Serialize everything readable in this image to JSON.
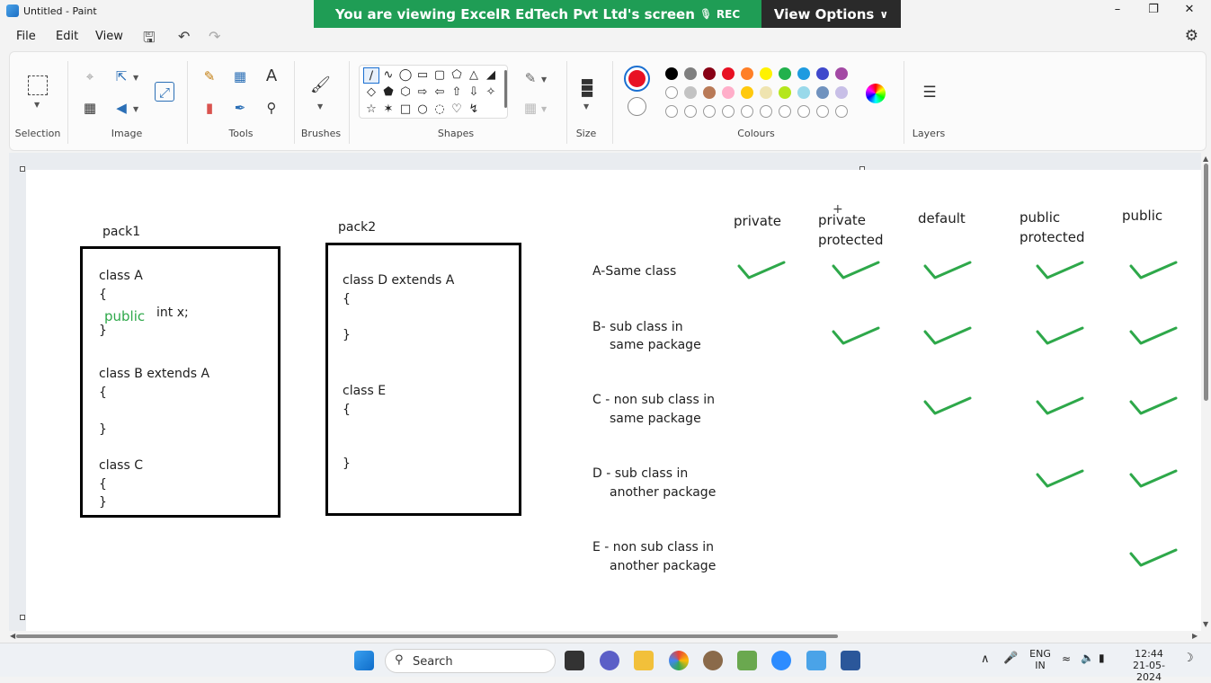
{
  "window": {
    "title": "Untitled - Paint"
  },
  "share_banner": {
    "text": "You are viewing  ExcelR EdTech Pvt Ltd's screen",
    "rec": "REC",
    "view_options": "View Options"
  },
  "menu": {
    "file": "File",
    "edit": "Edit",
    "view": "View"
  },
  "ribbon": {
    "groups": {
      "selection": "Selection",
      "image": "Image",
      "tools": "Tools",
      "brushes": "Brushes",
      "shapes": "Shapes",
      "size": "Size",
      "colours": "Colours",
      "layers": "Layers"
    },
    "tool_glyphs": {
      "text": "A"
    },
    "colors": {
      "primary": "#e81123",
      "row1": [
        "#000000",
        "#7f7f7f",
        "#880015",
        "#e81123",
        "#ff7f27",
        "#fff200",
        "#22b14c",
        "#1e9be0",
        "#3f48cc",
        "#a349a4"
      ],
      "row2": [
        "#ffffff",
        "#c3c3c3",
        "#b97a57",
        "#ffaec9",
        "#ffc90e",
        "#efe4b0",
        "#b5e61d",
        "#99d9ea",
        "#7092be",
        "#c8bfe7"
      ]
    }
  },
  "canvas": {
    "pack1": {
      "label": "pack1",
      "lines": [
        "class A",
        "{",
        "int x;",
        "}",
        "class B extends A",
        "{",
        "}",
        "class C",
        "{",
        "}"
      ],
      "modifier": "public"
    },
    "pack2": {
      "label": "pack2",
      "lines": [
        "class D extends A",
        "{",
        "}",
        "class E",
        "{",
        "}"
      ]
    },
    "table": {
      "columns": [
        "private",
        "private protected",
        "default",
        "public protected",
        "public"
      ],
      "columns_split": [
        [
          "private"
        ],
        [
          "private",
          "protected"
        ],
        [
          "default"
        ],
        [
          "public",
          "protected"
        ],
        [
          "public"
        ]
      ],
      "rows": [
        {
          "label": [
            "A-Same class"
          ],
          "checks": [
            true,
            true,
            true,
            true,
            true
          ]
        },
        {
          "label": [
            "B- sub class in",
            "same package"
          ],
          "checks": [
            false,
            true,
            true,
            true,
            true
          ]
        },
        {
          "label": [
            "C - non sub class in",
            "same package"
          ],
          "checks": [
            false,
            false,
            true,
            true,
            true
          ]
        },
        {
          "label": [
            "D - sub class in",
            "another package"
          ],
          "checks": [
            false,
            false,
            false,
            true,
            true
          ]
        },
        {
          "label": [
            "E - non sub class in",
            "another package"
          ],
          "checks": [
            false,
            false,
            false,
            false,
            true
          ]
        }
      ],
      "check_color": "#2ea84a"
    }
  },
  "taskbar": {
    "search": "Search",
    "lang": "ENG",
    "region": "IN",
    "time": "12:44",
    "date": "21-05-2024"
  }
}
